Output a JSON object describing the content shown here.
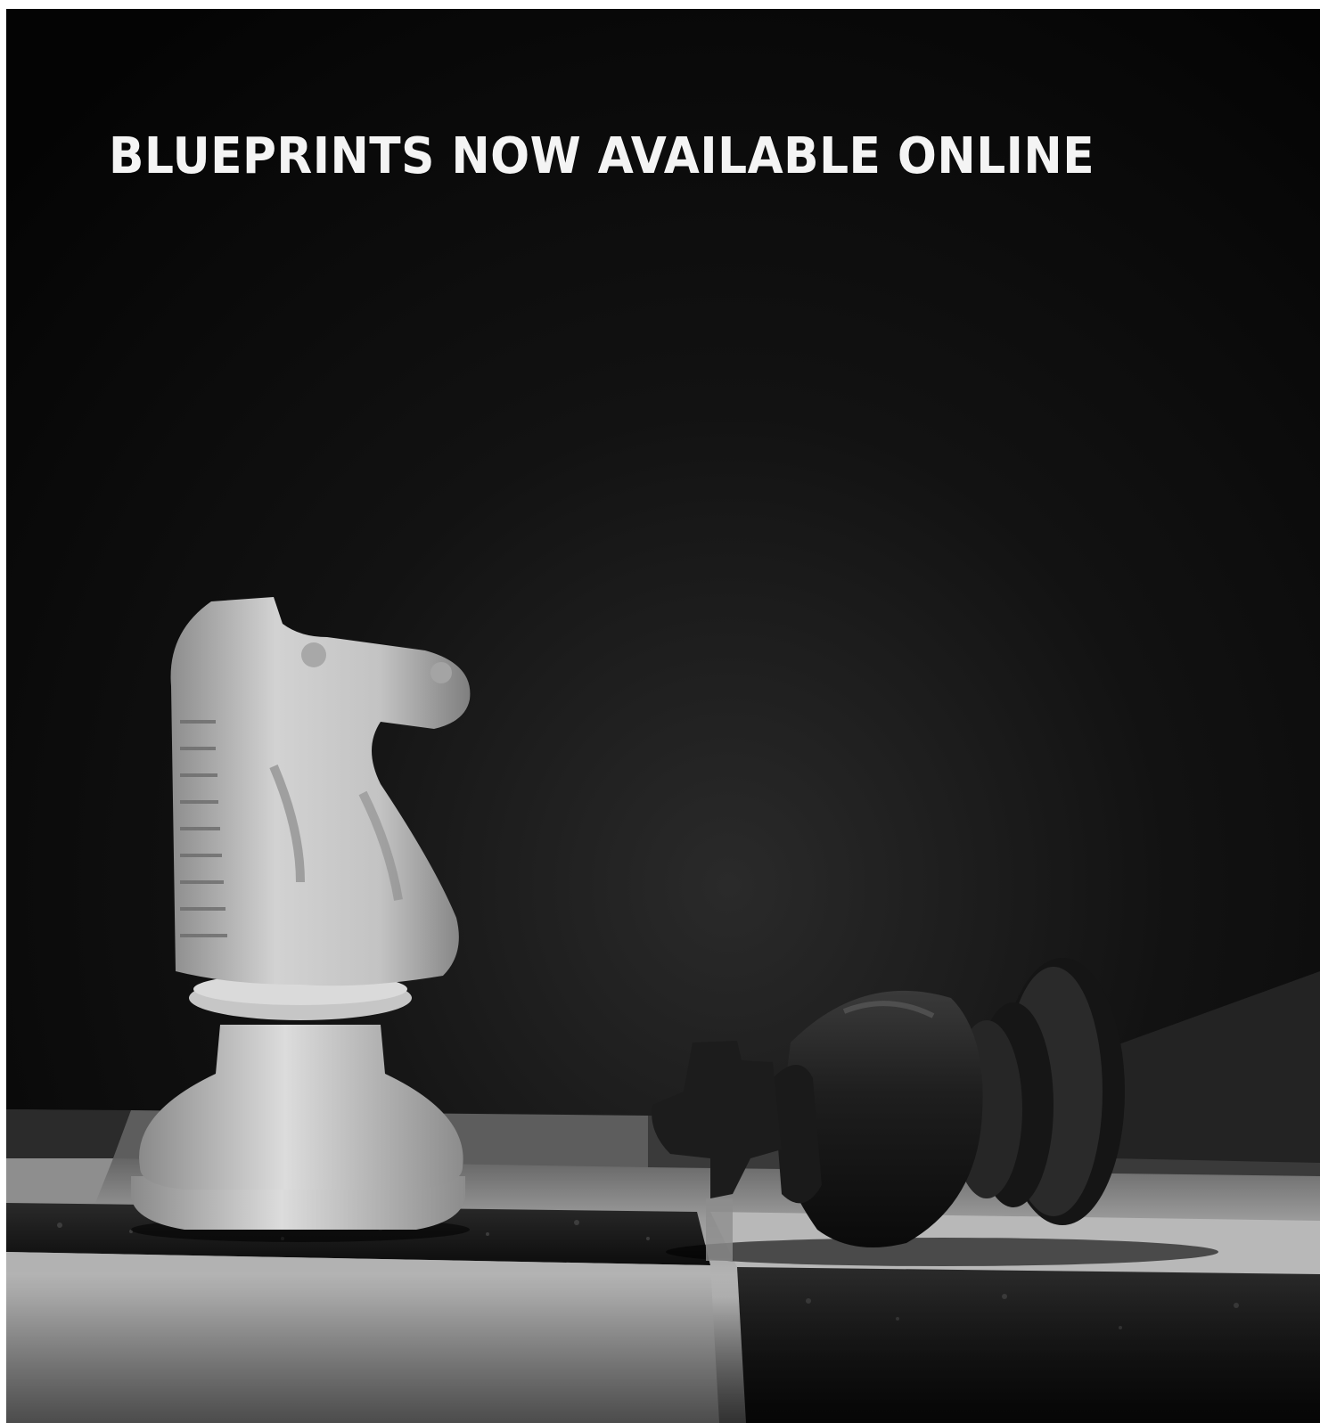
{
  "headline": "BLUEPRINTS NOW AVAILABLE ONLINE",
  "colors": {
    "background": "#050505",
    "headline_text": "#f4f4f4",
    "white_piece": "#c9c9c9",
    "black_piece": "#1b1b1b"
  },
  "scene": {
    "pieces": [
      "white-knight",
      "fallen-black-king"
    ],
    "board": "chessboard"
  }
}
